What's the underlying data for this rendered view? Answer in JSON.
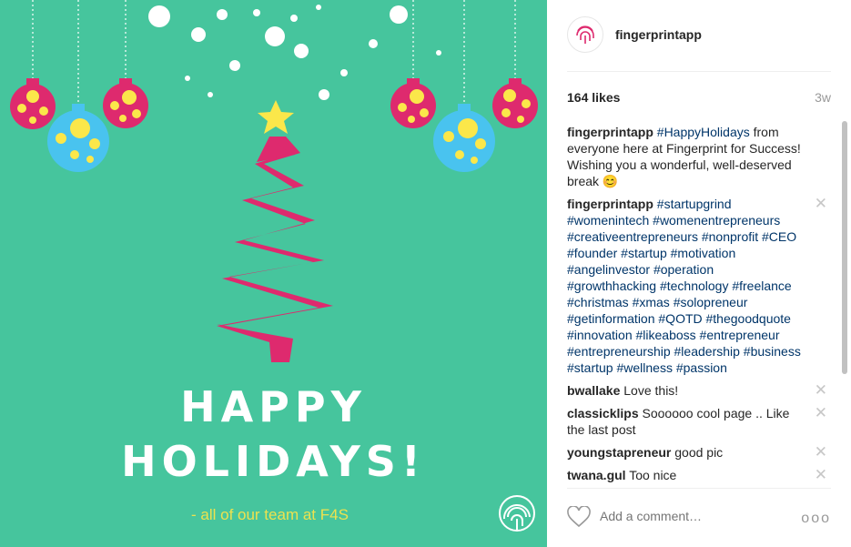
{
  "media": {
    "headline_line1": "HAPPY",
    "headline_line2": "HOLIDAYS!",
    "signature": "- all of our team at F4S",
    "background_color": "#46c59d",
    "accent_pink": "#de2a6e",
    "accent_blue": "#49c3ef",
    "accent_yellow": "#fbe74a"
  },
  "header": {
    "username": "fingerprintapp",
    "avatar_icon": "fingerprint-icon"
  },
  "stats": {
    "likes": "164 likes",
    "age": "3w"
  },
  "caption": {
    "username": "fingerprintapp",
    "hashtag": "#HappyHolidays",
    "text": " from everyone here at Fingerprint for Success! Wishing you a wonderful, well-deserved break ",
    "emoji": "😊"
  },
  "comments": [
    {
      "username": "fingerprintapp",
      "text": "#startupgrind #womenintech #womenentrepreneurs #creativeentrepreneurs #nonprofit #CEO #founder #startup #motivation #angelinvestor #operation #growthhacking #technology #freelance #christmas #xmas #solopreneur #getinformation #QOTD #thegoodquote #innovation #likeaboss #entrepreneur #entrepreneurship #leadership #business #startup #wellness #passion"
    },
    {
      "username": "bwallake",
      "text": "Love this!"
    },
    {
      "username": "classicklips",
      "text": "Soooooo cool page .. Like the last post"
    },
    {
      "username": "youngstapreneur",
      "text": "good pic"
    },
    {
      "username": "twana.gul",
      "text": "Too nice"
    }
  ],
  "delete_glyph": "✕",
  "footer": {
    "like_icon": "heart-icon",
    "comment_placeholder": "Add a comment…",
    "more_glyph": "ooo"
  }
}
